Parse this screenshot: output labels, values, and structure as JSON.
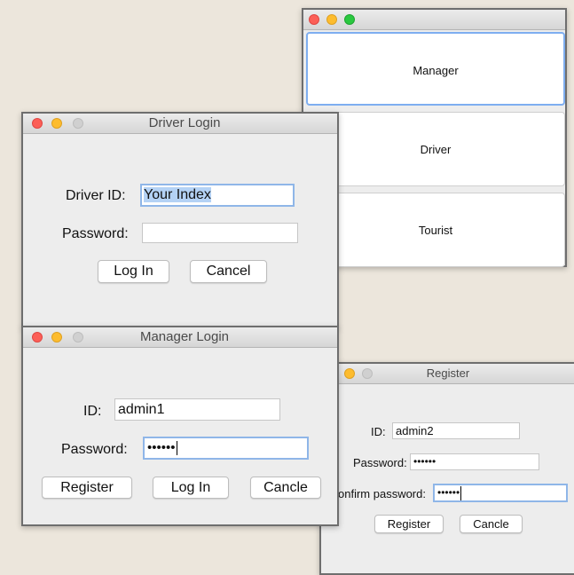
{
  "role_window": {
    "buttons": [
      {
        "label": "Manager"
      },
      {
        "label": "Driver"
      },
      {
        "label": "Tourist"
      }
    ]
  },
  "driver_login": {
    "title": "Driver Login",
    "id_label": "Driver ID:",
    "id_value": "Your Index",
    "password_label": "Password:",
    "password_value": "",
    "login_button": "Log In",
    "cancel_button": "Cancel"
  },
  "manager_login": {
    "title": "Manager Login",
    "id_label": "ID:",
    "id_value": "admin1",
    "password_label": "Password:",
    "password_value": "••••••",
    "register_button": "Register",
    "login_button": "Log In",
    "cancel_button": "Cancle"
  },
  "register": {
    "title": "Register",
    "id_label": "ID:",
    "id_value": "admin2",
    "password_label": "Password:",
    "password_value": "••••••",
    "confirm_label": "onfirm password:",
    "confirm_value": "••••••",
    "register_button": "Register",
    "cancel_button": "Cancle"
  }
}
